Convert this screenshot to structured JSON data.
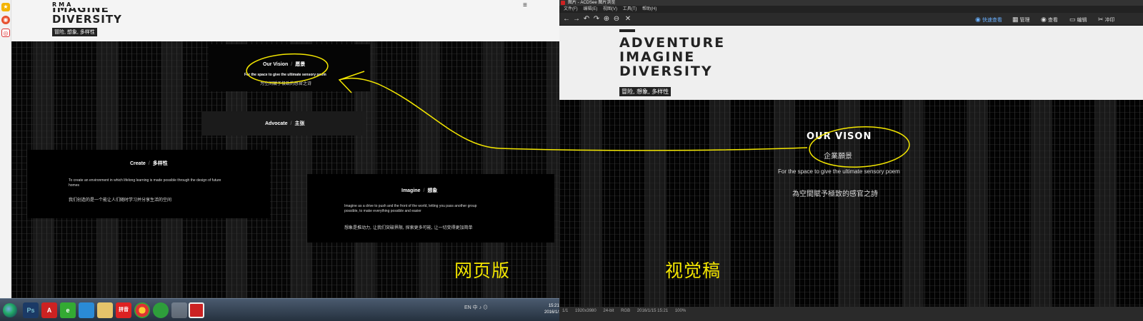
{
  "left": {
    "brand": "RMA",
    "title_lines": [
      "IMAGINE",
      "DIVERSITY"
    ],
    "tagline": "冒险, 想象, 多样性",
    "menu_icon": "≡",
    "cards": {
      "vision": {
        "title": "Our Vision",
        "title_cn": "愿景",
        "text": "For the space to give the ultimate sensory poem",
        "text_cn": "为空间赋予极致的感官之诗"
      },
      "advocate": {
        "title": "Advocate",
        "title_cn": "主张"
      },
      "create": {
        "title": "Create",
        "title_cn": "多样性",
        "text": "To create an environment in which lifelong learning is made possible through the design of future homes",
        "text_cn": "我们创造的是一个能让人们随时学习并分享生活的空间"
      },
      "imagine": {
        "title": "Imagine",
        "title_cn": "想象",
        "text": "Imagine as a drive to push and the front of the world, letting you pass another group possible, to make everything possible and easier",
        "text_cn": "想象是推动力, 让我们突破界限, 探索更多可能, 让一切变得更加简单"
      }
    },
    "overlay_label": "网页版",
    "taskbar": {
      "items": [
        "Ps",
        "A",
        "e",
        "",
        "",
        "拼音",
        "",
        "",
        ""
      ],
      "tray": "EN 中 ♪ ⊙",
      "time": "15:21",
      "date": "2016/1/15"
    }
  },
  "right": {
    "window_title": "图片 - ACDSee 图片浏览",
    "menu": [
      "文件(F)",
      "编辑(E)",
      "视图(V)",
      "工具(T)",
      "帮助(H)"
    ],
    "toolbar_left": [
      "←",
      "→",
      "↶",
      "↷",
      "⊕",
      "⊖",
      "✕"
    ],
    "toolbar_right": {
      "quick_view": "快速查看",
      "manage": "管理",
      "view": "查看",
      "edit": "编辑",
      "develop": "冲印"
    },
    "title_lines": [
      "ADVENTURE",
      "IMAGINE",
      "DIVERSITY"
    ],
    "tagline": "冒险, 想象, 多样性",
    "vision": {
      "title": "OUR VISON",
      "title_cn": "企業願景",
      "poem": "For the space to give the ultimate sensory poem",
      "poem_cn": "為空間賦予極致的感官之詩"
    },
    "overlay_label": "视觉稿",
    "status": [
      "1/1",
      "1920x3980",
      "24-bit",
      "RGB",
      "2016/1/15 15:21",
      "100%"
    ]
  },
  "colors": {
    "annotation_yellow": "#f3e600",
    "dark_bg": "#050505"
  }
}
